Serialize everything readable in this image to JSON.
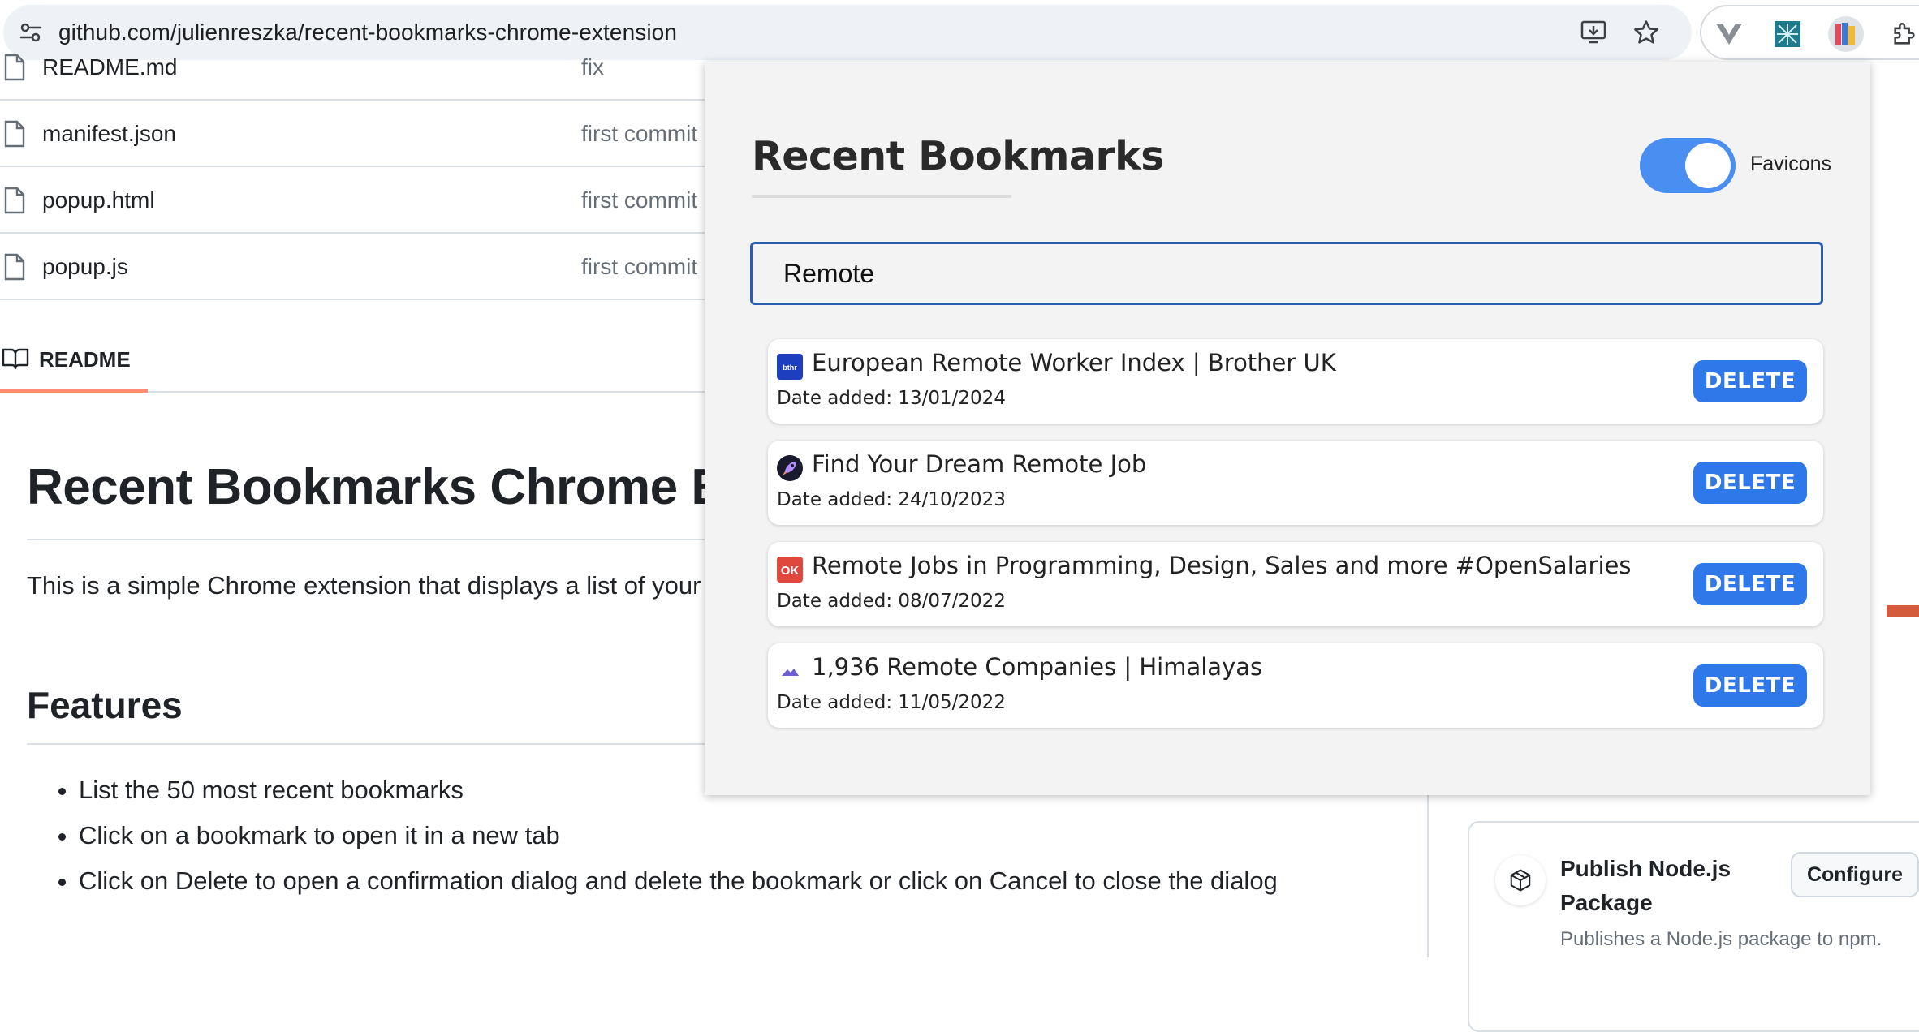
{
  "browser": {
    "url": "github.com/julienreszka/recent-bookmarks-chrome-extension",
    "icons": [
      "site-info-icon",
      "install-app-icon",
      "bookmark-star-icon",
      "extension-v-icon",
      "extension-network-icon",
      "extension-books-icon",
      "extensions-puzzle-icon"
    ]
  },
  "repo": {
    "files": [
      {
        "name": "README.md",
        "message": "fix"
      },
      {
        "name": "manifest.json",
        "message": "first commit"
      },
      {
        "name": "popup.html",
        "message": "first commit"
      },
      {
        "name": "popup.js",
        "message": "first commit"
      }
    ],
    "readme_tab": "README",
    "heading": "Recent Bookmarks Chrome Extension",
    "intro": "This is a simple Chrome extension that displays a list of your recent bookmarks when you click on the extension icon.",
    "features_heading": "Features",
    "features": [
      "List the 50 most recent bookmarks",
      "Click on a bookmark to open it in a new tab",
      "Click on Delete to open a confirmation dialog and delete the bookmark or click on Cancel to close the dialog"
    ]
  },
  "sidebar": {
    "action_title": "Publish Node.js Package",
    "action_desc": "Publishes a Node.js package to npm.",
    "configure_label": "Configure"
  },
  "popup": {
    "title": "Recent Bookmarks",
    "toggle_label": "Favicons",
    "toggle_on": true,
    "search_value": "Remote",
    "delete_label": "DELETE",
    "accent_color": "#2f78ea",
    "bookmarks": [
      {
        "title": "European Remote Worker Index | Brother UK",
        "date": "Date added: 13/01/2024",
        "favicon": "brother-favicon-icon"
      },
      {
        "title": "Find Your Dream Remote Job",
        "date": "Date added: 24/10/2023",
        "favicon": "rocket-favicon-icon"
      },
      {
        "title": "Remote Jobs in Programming, Design, Sales and more #OpenSalaries",
        "date": "Date added: 08/07/2022",
        "favicon": "ok-favicon-icon"
      },
      {
        "title": "1,936 Remote Companies | Himalayas",
        "date": "Date added: 11/05/2022",
        "favicon": "himalayas-favicon-icon"
      }
    ]
  }
}
